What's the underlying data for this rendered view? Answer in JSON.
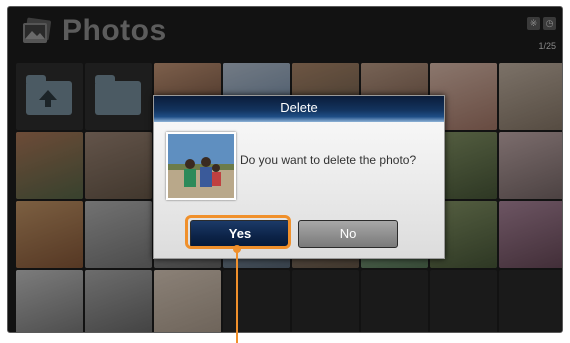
{
  "app": {
    "title": "Photos",
    "page_indicator": "1/25",
    "status_icons": [
      "bluetooth-icon",
      "clock-icon"
    ]
  },
  "grid": {
    "rows": [
      [
        {
          "kind": "folder",
          "icon": "folder-up-icon"
        },
        {
          "kind": "folder",
          "icon": "folder-icon"
        },
        {
          "kind": "photo",
          "colors": [
            "#6b4a3a",
            "#c99a7a"
          ]
        },
        {
          "kind": "photo",
          "colors": [
            "#6f8aa8",
            "#b9c6d6"
          ]
        },
        {
          "kind": "photo",
          "colors": [
            "#6a5c4c",
            "#b08a6c"
          ]
        },
        {
          "kind": "photo",
          "colors": [
            "#7a5a4a",
            "#c0a08a"
          ]
        },
        {
          "kind": "photo",
          "colors": [
            "#a87a6a",
            "#e0c0b0"
          ]
        },
        {
          "kind": "photo",
          "colors": [
            "#8a7a6a",
            "#c8b8a8"
          ]
        }
      ],
      [
        {
          "kind": "photo",
          "colors": [
            "#5a6a4a",
            "#b07a5a"
          ]
        },
        {
          "kind": "photo",
          "colors": [
            "#6a5a4a",
            "#a08878"
          ]
        },
        {
          "kind": "photo",
          "colors": [
            "#7a6a5a",
            "#b09888"
          ]
        },
        {
          "kind": "photo",
          "colors": [
            "#5a7080",
            "#98a8b8"
          ]
        },
        {
          "kind": "photo",
          "colors": [
            "#6a6a5a",
            "#a8a898"
          ]
        },
        {
          "kind": "photo",
          "colors": [
            "#7a6050",
            "#b89888"
          ]
        },
        {
          "kind": "photo",
          "colors": [
            "#4a5a3a",
            "#8a9a6a"
          ]
        },
        {
          "kind": "photo",
          "colors": [
            "#7a6a6a",
            "#c8b0b0"
          ]
        }
      ],
      [
        {
          "kind": "photo",
          "colors": [
            "#8a5a3a",
            "#c89a6a"
          ]
        },
        {
          "kind": "photo",
          "colors": [
            "#7a7a7a",
            "#b8b8b8"
          ]
        },
        {
          "kind": "photo",
          "colors": [
            "#6a6a6a",
            "#a8a8a8"
          ]
        },
        {
          "kind": "photo",
          "colors": [
            "#5a6a7a",
            "#9aaaba"
          ]
        },
        {
          "kind": "photo",
          "colors": [
            "#6a5a4a",
            "#9a8a7a"
          ]
        },
        {
          "kind": "photo",
          "colors": [
            "#5a7a5a",
            "#9aba9a"
          ]
        },
        {
          "kind": "photo",
          "colors": [
            "#4a5a3a",
            "#8a9a6a"
          ]
        },
        {
          "kind": "photo",
          "colors": [
            "#6a4a5a",
            "#b08aa0"
          ]
        }
      ],
      [
        {
          "kind": "photo",
          "colors": [
            "#7a7a7a",
            "#c8c8c8"
          ]
        },
        {
          "kind": "photo",
          "colors": [
            "#6a6a6a",
            "#b0b0b0"
          ]
        },
        {
          "kind": "photo",
          "colors": [
            "#b0a090",
            "#e0d0c0"
          ]
        },
        {
          "kind": "empty"
        },
        {
          "kind": "empty"
        },
        {
          "kind": "empty"
        },
        {
          "kind": "empty"
        },
        {
          "kind": "empty"
        }
      ]
    ]
  },
  "dialog": {
    "title": "Delete",
    "message": "Do you want to delete the photo?",
    "yes_label": "Yes",
    "no_label": "No",
    "highlight_color": "#f0902b",
    "title_bar_color": "#13345f"
  }
}
